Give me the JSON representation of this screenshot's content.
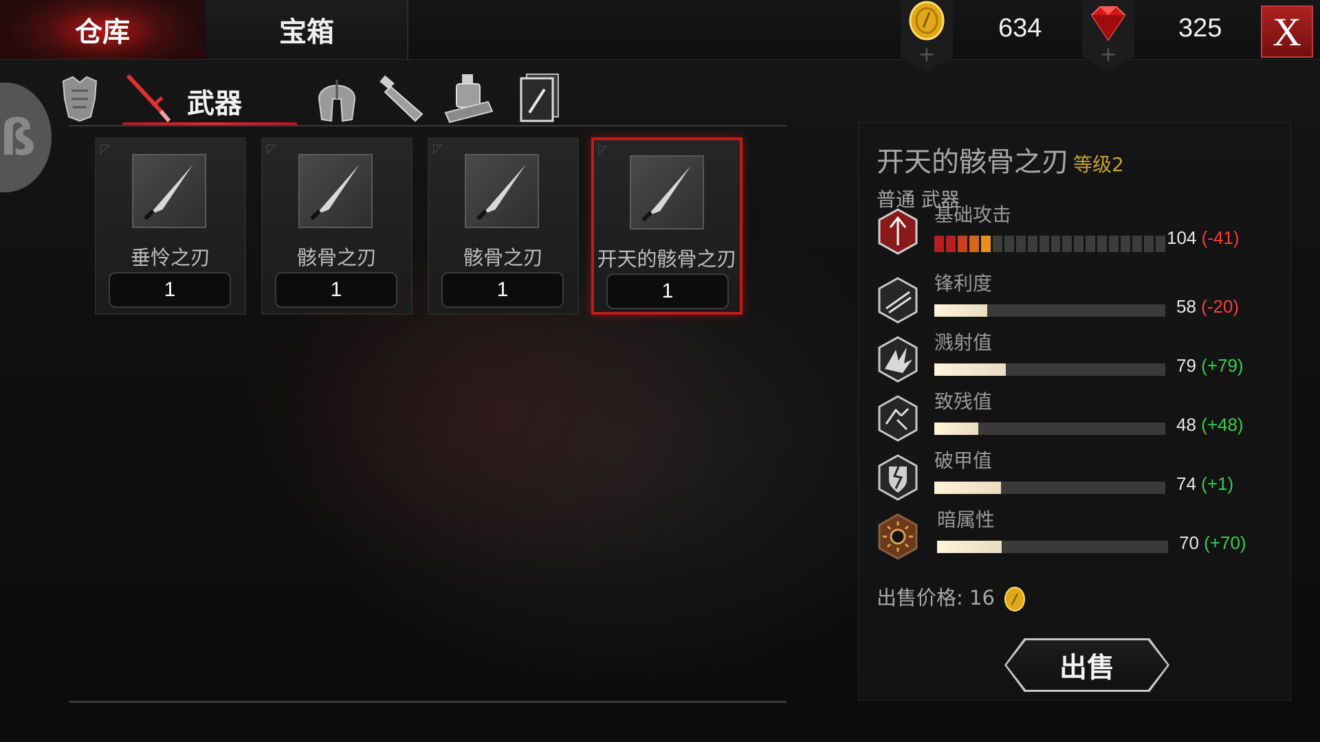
{
  "tabs": {
    "warehouse": "仓库",
    "chest": "宝箱"
  },
  "currency": {
    "gold": "634",
    "gems": "325"
  },
  "close_label": "X",
  "category": {
    "active_label": "武器"
  },
  "items": [
    {
      "name": "垂怜之刃",
      "count": "1"
    },
    {
      "name": "骸骨之刃",
      "count": "1"
    },
    {
      "name": "骸骨之刃",
      "count": "1"
    },
    {
      "name": "开天的骸骨之刃",
      "count": "1"
    }
  ],
  "detail": {
    "name": "开天的骸骨之刃",
    "level": "等级2",
    "subtitle": "普通 武器",
    "stats": [
      {
        "label": "基础攻击",
        "value": "104",
        "delta": "(-41)",
        "delta_type": "neg",
        "fill": 0.18
      },
      {
        "label": "锋利度",
        "value": "58",
        "delta": "(-20)",
        "delta_type": "neg",
        "fill": 0.23
      },
      {
        "label": "溅射值",
        "value": "79",
        "delta": "(+79)",
        "delta_type": "pos",
        "fill": 0.31
      },
      {
        "label": "致残值",
        "value": "48",
        "delta": "(+48)",
        "delta_type": "pos",
        "fill": 0.19
      },
      {
        "label": "破甲值",
        "value": "74",
        "delta": "(+1)",
        "delta_type": "pos",
        "fill": 0.29
      },
      {
        "label": "暗属性",
        "value": "70",
        "delta": "(+70)",
        "delta_type": "pos",
        "fill": 0.28
      }
    ],
    "sell_price_label": "出售价格:",
    "sell_price": "16",
    "sell_button": "出售"
  },
  "colors": {
    "accent_red": "#c11a1a",
    "gold": "#c9a227",
    "positive": "#35d04a",
    "negative": "#ff3a3a"
  }
}
